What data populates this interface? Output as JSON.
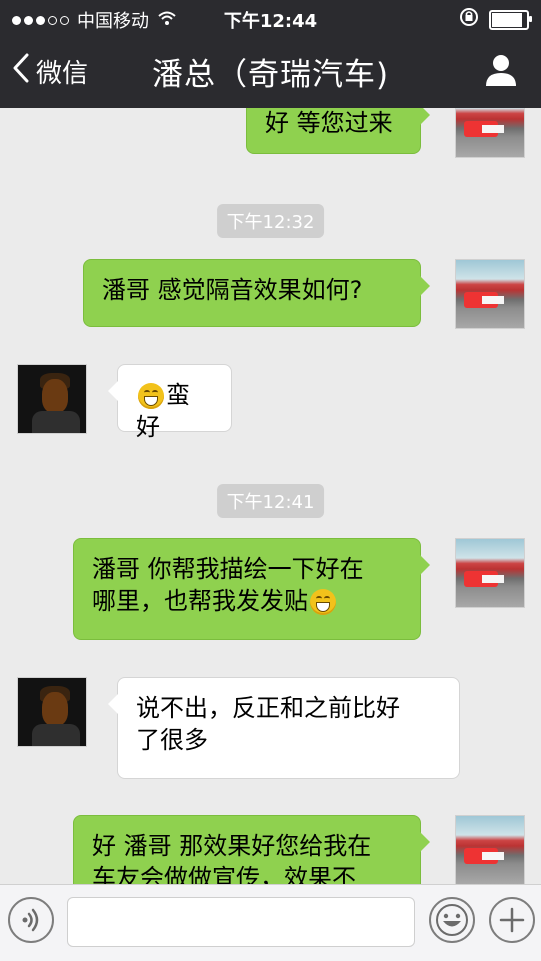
{
  "status_bar": {
    "carrier": "中国移动",
    "time": "下午12:44"
  },
  "nav": {
    "back_label": "微信",
    "title": "潘总（奇瑞汽车)"
  },
  "messages": {
    "m1_text": "好 等您过来",
    "t1": "下午12:32",
    "m2_text": "潘哥 感觉隔音效果如何?",
    "m3_text": "蛮好",
    "t2": "下午12:41",
    "m4_line1": "潘哥 你帮我描绘一下好在",
    "m4_line2": "哪里，也帮我发发贴",
    "m5_line1": "说不出，反正和之前比好",
    "m5_line2": "了很多",
    "m6_line1": "好 潘哥 那效果好您给我在",
    "m6_line2": "车友会做做宣传，效果不"
  },
  "icons": {
    "back": "chevron-left-icon",
    "profile": "person-icon",
    "voice": "voice-icon",
    "emoji": "smile-icon",
    "add": "plus-icon"
  },
  "colors": {
    "top_bar": "#2b2b2f",
    "sent_bubble": "#8fd14f",
    "received_bubble": "#ffffff",
    "background": "#ebebeb"
  }
}
